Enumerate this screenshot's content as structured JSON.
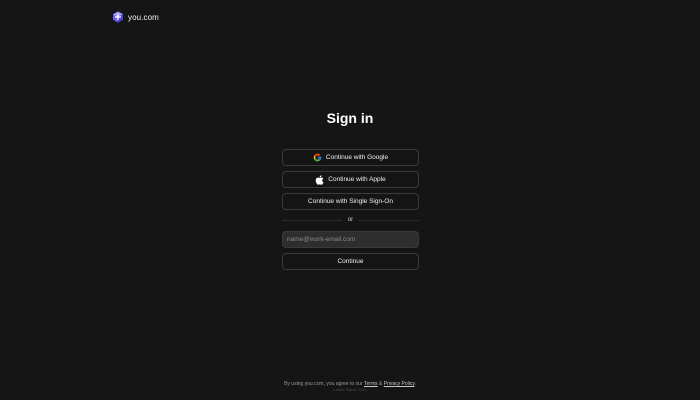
{
  "brand": {
    "logo_icon": "you-logo-icon",
    "name": "you.com",
    "accent": "#7b6cf6"
  },
  "signin": {
    "title": "Sign in",
    "google_label": "Continue with Google",
    "apple_label": "Continue with Apple",
    "sso_label": "Continue with Single Sign-On",
    "divider_text": "or",
    "email_placeholder": "name@work-email.com",
    "email_value": "",
    "continue_label": "Continue"
  },
  "footer": {
    "prefix": "By using you.com, you agree to our ",
    "terms_label": "Terms",
    "ampersand": " & ",
    "privacy_label": "Privacy Policy",
    "suffix": ".",
    "version_text": "Latest Stable 2025"
  },
  "colors": {
    "background": "#151515",
    "button_border": "#3a3a3a",
    "input_background": "#2e2e2e",
    "text": "#f0f0f0"
  }
}
